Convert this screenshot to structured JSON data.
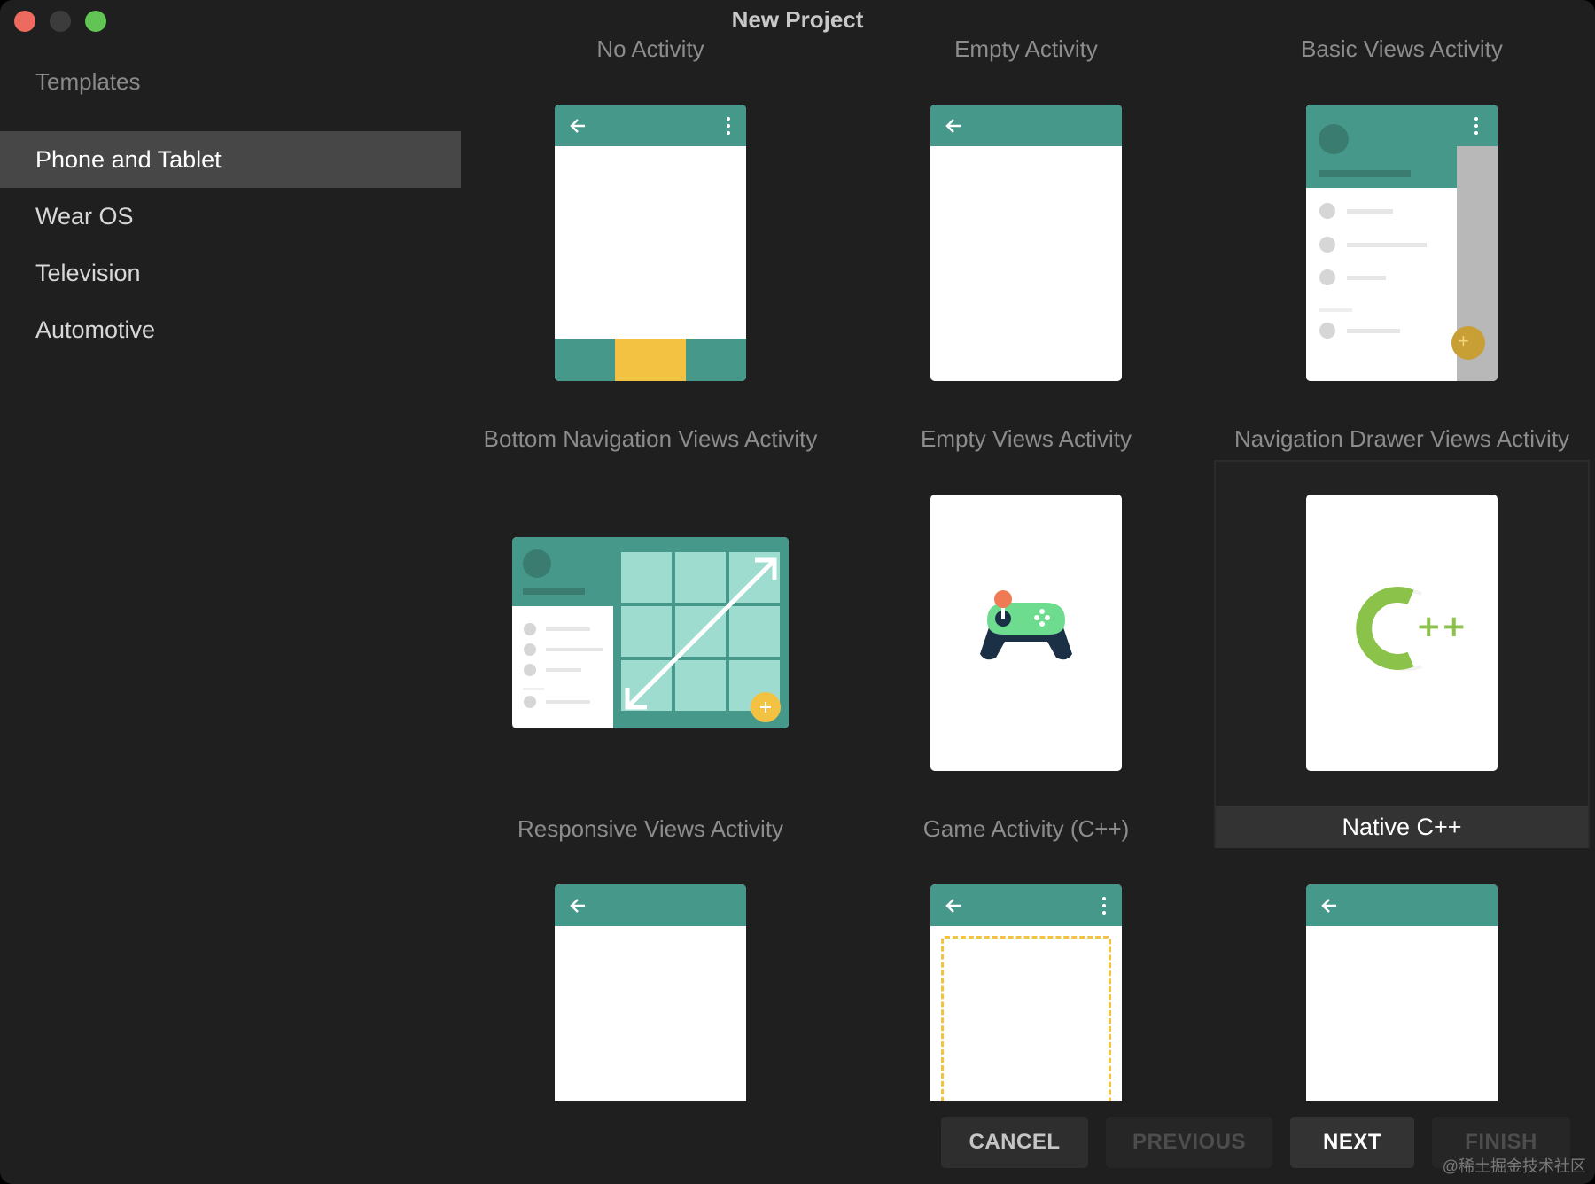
{
  "window": {
    "title": "New Project"
  },
  "sidebar": {
    "header": "Templates",
    "items": [
      {
        "label": "Phone and Tablet",
        "selected": true
      },
      {
        "label": "Wear OS",
        "selected": false
      },
      {
        "label": "Television",
        "selected": false
      },
      {
        "label": "Automotive",
        "selected": false
      }
    ]
  },
  "templates": [
    {
      "label": "No Activity"
    },
    {
      "label": "Empty Activity"
    },
    {
      "label": "Basic Views Activity"
    },
    {
      "label": "Bottom Navigation Views Activity"
    },
    {
      "label": "Empty Views Activity"
    },
    {
      "label": "Navigation Drawer Views Activity"
    },
    {
      "label": "Responsive Views Activity"
    },
    {
      "label": "Game Activity (C++)"
    },
    {
      "label": "Native C++",
      "selected": true
    }
  ],
  "buttons": {
    "cancel": "CANCEL",
    "previous": "PREVIOUS",
    "next": "NEXT",
    "finish": "FINISH"
  },
  "icons": {
    "cplusplus_text": "++",
    "fab_plus": "+"
  },
  "watermark": "@稀土掘金技术社区",
  "colors": {
    "teal": "#46988a",
    "dark_teal": "#3a7d70",
    "yellow": "#f3c242",
    "light_teal": "#9fdcd0",
    "cpp_green": "#8bc34a"
  }
}
